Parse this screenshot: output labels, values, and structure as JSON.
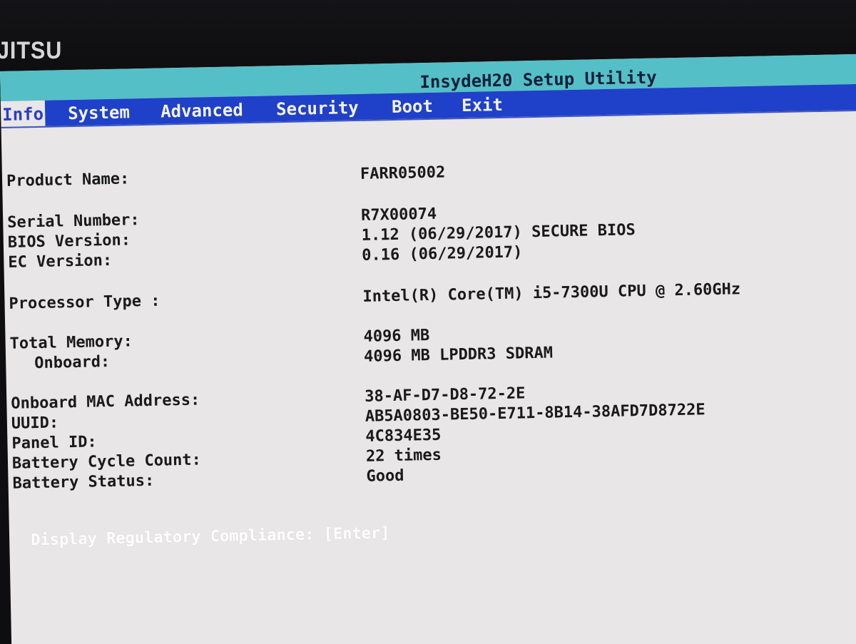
{
  "bezel": {
    "logo_text": "JITSU"
  },
  "window": {
    "title": "InsydeH20 Setup Utility"
  },
  "tabs": [
    {
      "label": "Info",
      "active": true
    },
    {
      "label": "System",
      "active": false
    },
    {
      "label": "Advanced",
      "active": false
    },
    {
      "label": "Security",
      "active": false
    },
    {
      "label": "Boot",
      "active": false
    },
    {
      "label": "Exit",
      "active": false
    }
  ],
  "info": {
    "product_name": {
      "label": "Product Name:",
      "value": "FARR05002"
    },
    "serial_number": {
      "label": "Serial Number:",
      "value": "R7X00074"
    },
    "bios_version": {
      "label": "BIOS Version:",
      "value": "1.12 (06/29/2017) SECURE BIOS"
    },
    "ec_version": {
      "label": "EC Version:",
      "value": "0.16 (06/29/2017)"
    },
    "processor_type": {
      "label": "Processor Type :",
      "value": "Intel(R) Core(TM) i5-7300U CPU @ 2.60GHz"
    },
    "total_memory": {
      "label": "Total Memory:",
      "value": "4096 MB"
    },
    "onboard_memory": {
      "label": "Onboard:",
      "value": "4096 MB LPDDR3 SDRAM"
    },
    "mac_address": {
      "label": "Onboard MAC Address:",
      "value": "38-AF-D7-D8-72-2E"
    },
    "uuid": {
      "label": "UUID:",
      "value": "AB5A0803-BE50-E711-8B14-38AFD7D8722E"
    },
    "panel_id": {
      "label": "Panel ID:",
      "value": "4C834E35"
    },
    "battery_cycle_count": {
      "label": "Battery Cycle Count:",
      "value": "22 times"
    },
    "battery_status": {
      "label": "Battery Status:",
      "value": "Good"
    }
  },
  "regulatory": {
    "label": "Display Regulatory Compliance:",
    "action": "[Enter]"
  },
  "colors": {
    "title_bar": "#55bfc7",
    "menu_bar": "#1f40c8",
    "content_background": "#e8e6e6",
    "text": "#1a1a1a",
    "highlight_text": "#ffffff"
  }
}
